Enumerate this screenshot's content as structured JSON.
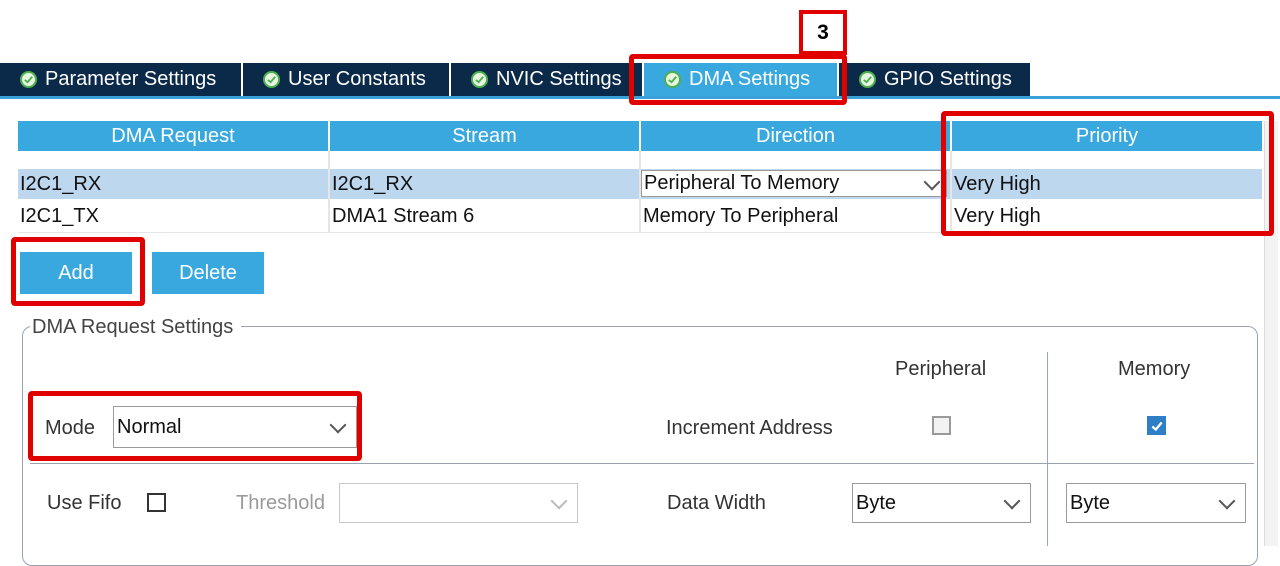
{
  "annotation": {
    "step": "3"
  },
  "tabs": [
    {
      "label": "Parameter Settings"
    },
    {
      "label": "User Constants"
    },
    {
      "label": "NVIC Settings"
    },
    {
      "label": "DMA Settings",
      "active": true
    },
    {
      "label": "GPIO Settings"
    }
  ],
  "table": {
    "headers": [
      "DMA Request",
      "Stream",
      "Direction",
      "Priority"
    ],
    "rows": [
      {
        "request": "I2C1_RX",
        "stream": "I2C1_RX",
        "direction": "Peripheral To Memory",
        "priority": "Very High",
        "selected": true
      },
      {
        "request": "I2C1_TX",
        "stream": "DMA1 Stream 6",
        "direction": "Memory To Peripheral",
        "priority": "Very High"
      }
    ]
  },
  "buttons": {
    "add": "Add",
    "delete": "Delete"
  },
  "settings": {
    "legend": "DMA Request Settings",
    "peripheral_header": "Peripheral",
    "memory_header": "Memory",
    "mode_label": "Mode",
    "mode_value": "Normal",
    "increment_label": "Increment Address",
    "increment_peripheral": false,
    "increment_memory": true,
    "use_fifo_label": "Use Fifo",
    "use_fifo": false,
    "threshold_label": "Threshold",
    "threshold_value": "",
    "data_width_label": "Data Width",
    "data_width_peripheral": "Byte",
    "data_width_memory": "Byte"
  },
  "colors": {
    "tab_dark": "#0b2a4a",
    "accent": "#39a8de",
    "highlight_red": "#e00000",
    "row_selected": "#bcd7ee"
  }
}
